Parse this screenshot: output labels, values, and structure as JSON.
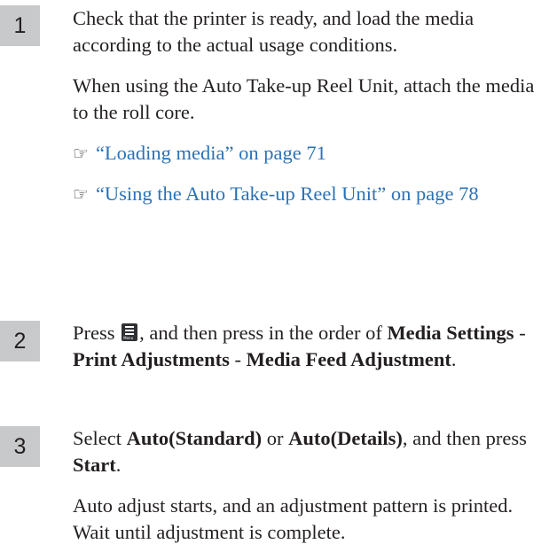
{
  "steps": [
    {
      "number": "1",
      "text": "Check that the printer is ready, and load the media according to the actual usage conditions.",
      "note": "When using the Auto Take-up Reel Unit, attach the media to the roll core.",
      "links": [
        "“Loading media” on page 71",
        "“Using the Auto Take-up Reel Unit” on page 78"
      ]
    },
    {
      "number": "2",
      "press": "Press",
      "mid": ", and then press in the order of",
      "menu1": "Media Settings",
      "sep1": " - ",
      "menu2": "Print Adjustments",
      "sep2": " - ",
      "menu3": "Media Feed Adjustment",
      "end": "."
    },
    {
      "number": "3",
      "select": "Select",
      "opt1": "Auto(Standard)",
      "or": " or ",
      "opt2": "Auto(Details)",
      "mid": ", and then press",
      "start": "Start",
      "end": ".",
      "result": "Auto adjust starts, and an adjustment pattern is printed. Wait until adjustment is complete."
    }
  ],
  "icons": {
    "link": "reference-arrow-icon",
    "menu": "menu-icon",
    "menu_label": "Menu"
  },
  "colors": {
    "link": "#2a72b8",
    "step_badge": "#c8c9ca"
  }
}
